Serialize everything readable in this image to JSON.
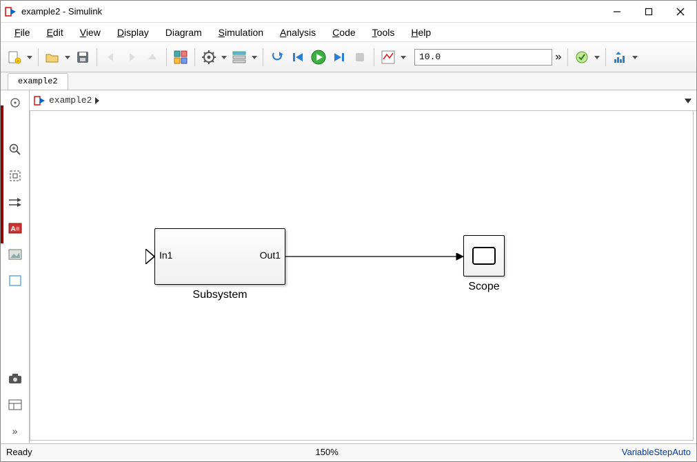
{
  "window": {
    "title": "example2 - Simulink"
  },
  "menu": {
    "file": "File",
    "edit": "Edit",
    "view": "View",
    "display": "Display",
    "diagram": "Diagram",
    "simulation": "Simulation",
    "analysis": "Analysis",
    "code": "Code",
    "tools": "Tools",
    "help": "Help"
  },
  "toolbar": {
    "stop_time": "10.0",
    "overflow": "»"
  },
  "tabs": {
    "active": "example2"
  },
  "breadcrumb": {
    "model": "example2"
  },
  "blocks": {
    "subsystem": {
      "name": "Subsystem",
      "in_port": "In1",
      "out_port": "Out1"
    },
    "scope": {
      "name": "Scope"
    }
  },
  "palette": {
    "expand": "»"
  },
  "status": {
    "state": "Ready",
    "zoom": "150%",
    "solver": "VariableStepAuto"
  }
}
